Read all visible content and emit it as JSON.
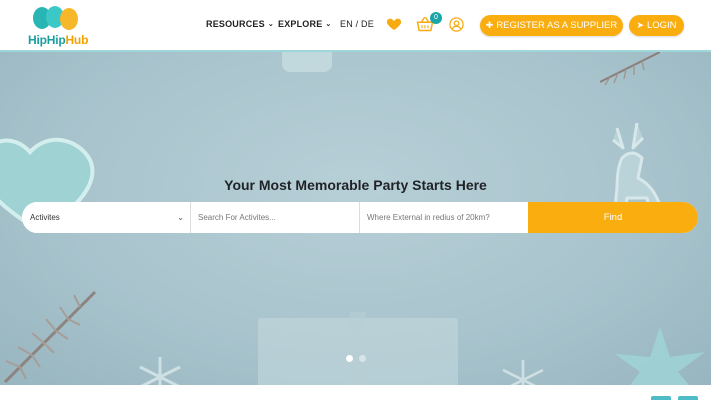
{
  "header": {
    "logo": {
      "hip": "HipHip",
      "hub": "Hub"
    },
    "nav": {
      "resources": "RESOURCES",
      "explore": "EXPLORE",
      "language": "EN / DE"
    },
    "cart_count": "0",
    "register_label": "REGISTER AS A SUPPLIER",
    "login_label": "LOGIN"
  },
  "hero": {
    "title": "Your Most Memorable Party Starts Here",
    "search": {
      "category_selected": "Activites",
      "activities_placeholder": "Search For Activites...",
      "location_placeholder": "Where External in redius of 20km?",
      "find_label": "Find"
    },
    "slider": {
      "current": 1,
      "total": 2
    }
  },
  "colors": {
    "accent": "#f9ad0f",
    "teal": "#1aa6a8",
    "hero_bg": "#a9c4cd"
  },
  "icons": [
    "heart-icon",
    "basket-icon",
    "user-icon",
    "user-plus-icon",
    "sign-in-icon",
    "chevron-down-icon"
  ]
}
